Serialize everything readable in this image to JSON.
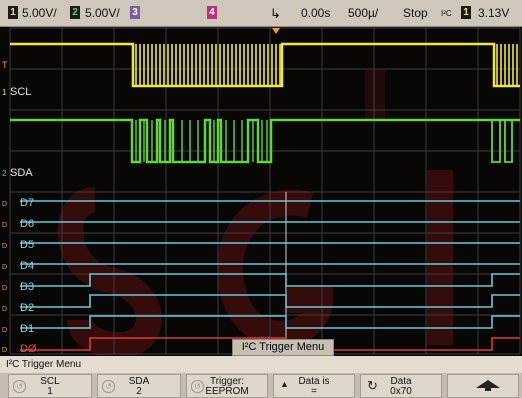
{
  "status": {
    "ch1_number": "1",
    "ch1_scale": "5.00V/",
    "ch2_number": "2",
    "ch2_scale": "5.00V/",
    "ch3_number": "3",
    "ch4_number": "4",
    "time_delay": "0.00s",
    "time_scale": "500µ/",
    "run_state": "Stop",
    "trigger_type": "I²C",
    "trigger_channel": "1",
    "trigger_level": "3.13V"
  },
  "traces": {
    "scl_label": "SCL",
    "sda_label": "SDA",
    "digital_labels": [
      "D7",
      "D6",
      "D5",
      "D4",
      "D3",
      "D2",
      "D1",
      "DØ"
    ],
    "ch1_marker": "1",
    "ch2_marker": "2",
    "trigger_marker": "T",
    "digital_marker": "D"
  },
  "overlay": {
    "message": "I²C Trigger Menu"
  },
  "menu": {
    "title": "I²C Trigger Menu",
    "softkeys": [
      {
        "line1": "SCL",
        "line2": "1"
      },
      {
        "line1": "SDA",
        "line2": "2"
      },
      {
        "line1": "Trigger:",
        "line2": "EEPROM"
      },
      {
        "line1": "Data is",
        "line2": "="
      },
      {
        "line1": "Data",
        "line2": "0x70"
      }
    ]
  },
  "colors": {
    "ch1": "#f0e83a",
    "ch2": "#62d63a",
    "digital": "#6ec6d8",
    "d0": "#e03a3a",
    "status_bg": "#cfc7b9"
  }
}
